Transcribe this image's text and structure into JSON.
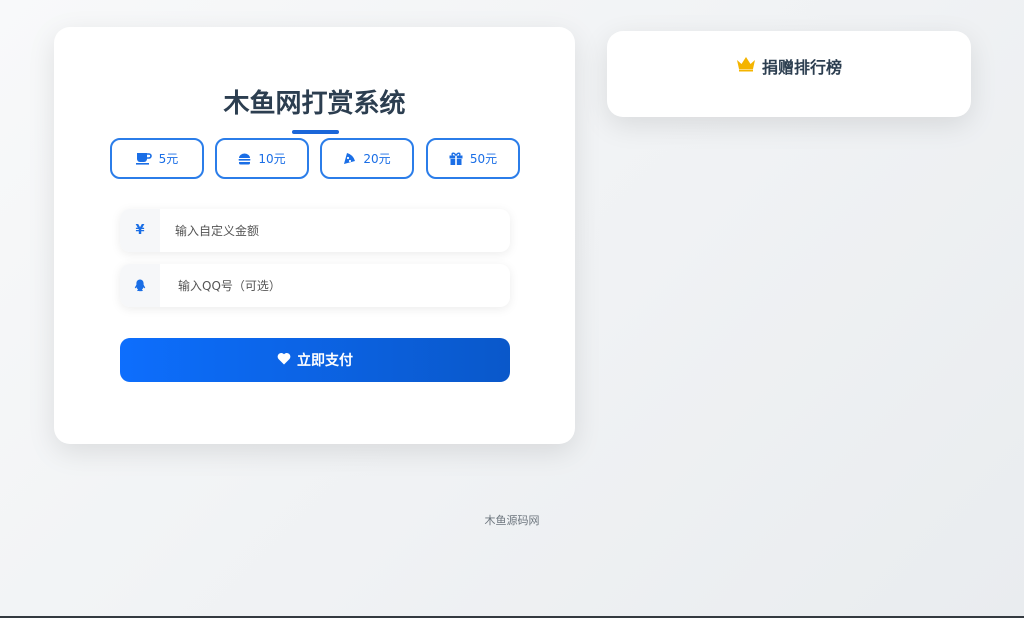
{
  "main": {
    "title": "木鱼网打赏系统",
    "amount_buttons": [
      {
        "label": "5元",
        "icon": "coffee-icon"
      },
      {
        "label": "10元",
        "icon": "burger-icon"
      },
      {
        "label": "20元",
        "icon": "pizza-icon"
      },
      {
        "label": "50元",
        "icon": "gift-icon"
      }
    ],
    "custom_amount": {
      "icon_glyph": "¥",
      "placeholder": "输入自定义金额",
      "value": ""
    },
    "qq": {
      "icon": "qq-penguin-icon",
      "placeholder": "输入QQ号（可选）",
      "value": ""
    },
    "pay_button": {
      "label": "立即支付",
      "icon": "heart-icon"
    }
  },
  "ranking": {
    "title": "捐赠排行榜",
    "icon": "crown-icon"
  },
  "footer": {
    "text": "木鱼源码网"
  },
  "colors": {
    "accent": "#0d6efd",
    "accent_dark": "#0a58ca",
    "title": "#2c3e50",
    "crown": "#f4b400"
  }
}
